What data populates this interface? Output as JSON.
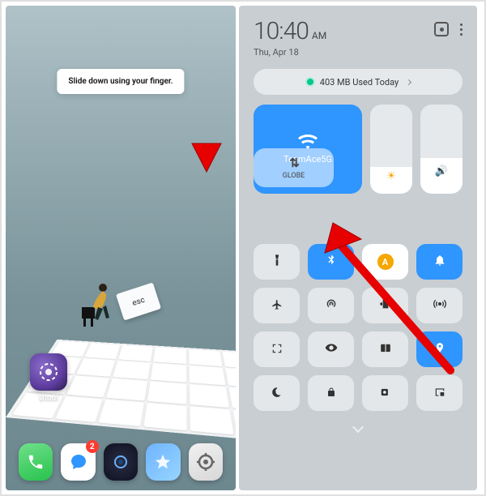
{
  "left": {
    "tooltip": "Slide down using your finger.",
    "esc_label": "esc",
    "app": {
      "label": "Utool"
    },
    "dock_badge": "2"
  },
  "right": {
    "time": "10:40",
    "ampm": "AM",
    "date": "Thu, Apr 18",
    "data_usage": "403 MB Used Today",
    "wifi_name": "TeamAce5G",
    "mobile_data_label": "GLOBE",
    "toggles": [
      {
        "id": "flashlight",
        "icon": "flashlight",
        "on": false
      },
      {
        "id": "bluetooth",
        "icon": "bluetooth",
        "on": true,
        "variant": "blue"
      },
      {
        "id": "auto-brightness",
        "icon": "auto",
        "on": true,
        "variant": "white"
      },
      {
        "id": "notifications",
        "icon": "bell",
        "on": true,
        "variant": "blue"
      },
      {
        "id": "airplane",
        "icon": "airplane",
        "on": false
      },
      {
        "id": "hotspot",
        "icon": "hotspot",
        "on": false
      },
      {
        "id": "vibrate",
        "icon": "vibrate",
        "on": false
      },
      {
        "id": "nfc",
        "icon": "signal",
        "on": false
      },
      {
        "id": "screenshot",
        "icon": "screenshot",
        "on": false
      },
      {
        "id": "eye-comfort",
        "icon": "eye",
        "on": false
      },
      {
        "id": "ebook",
        "icon": "book",
        "on": false
      },
      {
        "id": "location",
        "icon": "location",
        "on": true,
        "variant": "blue"
      },
      {
        "id": "dnd",
        "icon": "moon",
        "on": false
      },
      {
        "id": "lock",
        "icon": "lock",
        "on": false
      },
      {
        "id": "screen-record",
        "icon": "record",
        "on": false
      },
      {
        "id": "cast",
        "icon": "cast",
        "on": false
      }
    ]
  }
}
